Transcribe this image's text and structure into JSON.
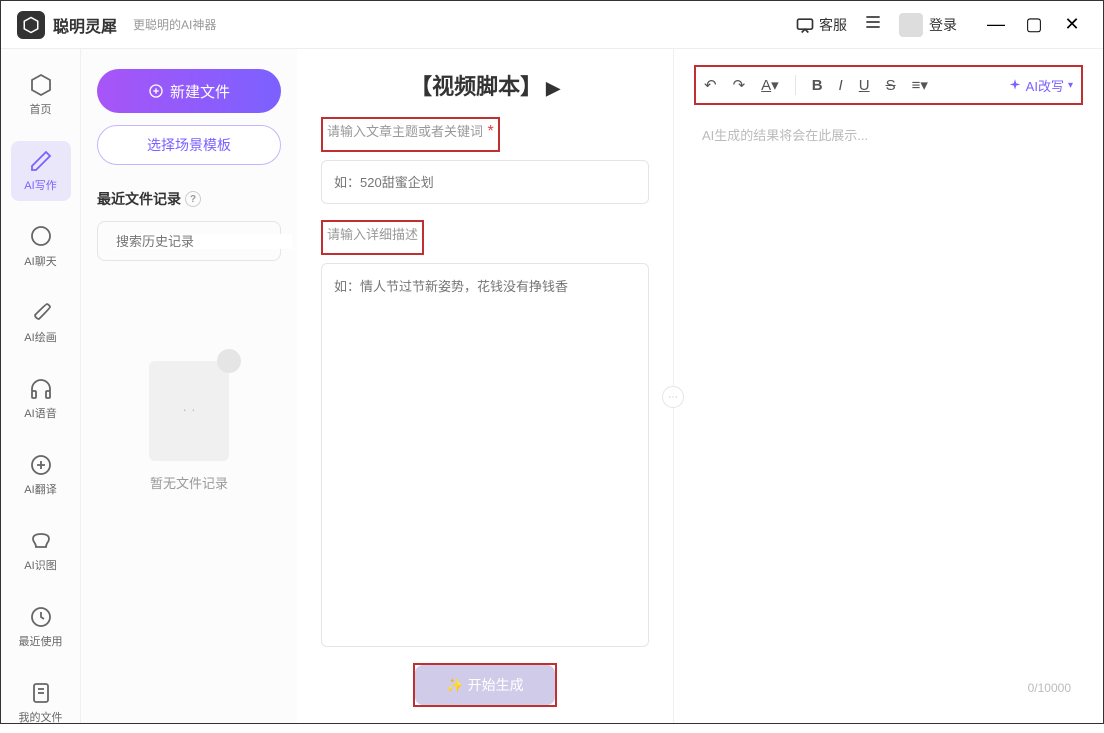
{
  "titlebar": {
    "app_name": "聪明灵犀",
    "tagline": "更聪明的AI神器",
    "kefu": "客服",
    "login": "登录"
  },
  "sidebar": {
    "items": [
      {
        "label": "首页"
      },
      {
        "label": "AI写作"
      },
      {
        "label": "AI聊天"
      },
      {
        "label": "AI绘画"
      },
      {
        "label": "AI语音"
      },
      {
        "label": "AI翻译"
      },
      {
        "label": "AI识图"
      },
      {
        "label": "最近使用"
      },
      {
        "label": "我的文件"
      }
    ]
  },
  "left_panel": {
    "new_file": "新建文件",
    "scene_template": "选择场景模板",
    "recent_title": "最近文件记录",
    "search_placeholder": "搜索历史记录",
    "empty_text": "暂无文件记录"
  },
  "center": {
    "title": "【视频脚本】",
    "field1_label": "请输入文章主题或者关键词",
    "field1_placeholder": "如：520甜蜜企划",
    "field2_label": "请输入详细描述",
    "field2_placeholder": "如：情人节过节新姿势，花钱没有挣钱香",
    "generate_btn": "✨ 开始生成"
  },
  "right": {
    "ai_rewrite": "AI改写",
    "output_placeholder": "AI生成的结果将会在此展示...",
    "char_count": "0/10000"
  }
}
